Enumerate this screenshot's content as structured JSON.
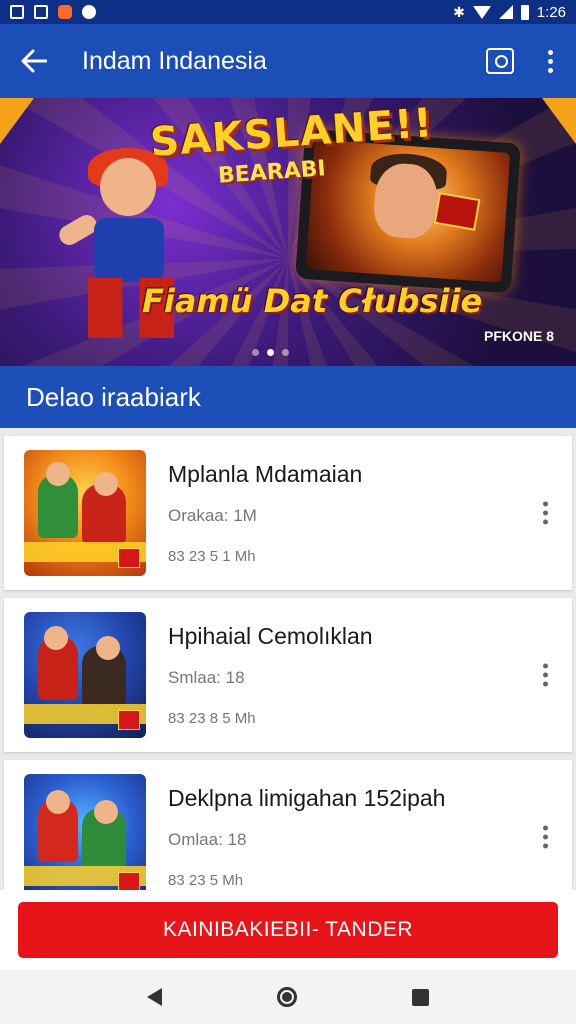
{
  "status_bar": {
    "time": "1:26"
  },
  "app_bar": {
    "title": "Indam Indanesia"
  },
  "banner": {
    "headline": "SAKSLANE!!",
    "sub": "BEARABI",
    "tagline": "Fiamü Dat Cłubsiie",
    "code": "PFKONE 8"
  },
  "section": {
    "title": "Delao iraabiark"
  },
  "items": [
    {
      "title": "Mplanla Mdamaian",
      "meta": "Orakaa: 1M",
      "size": "83 23 5 1 Mh"
    },
    {
      "title": "Hpihaial Cemolıklan",
      "meta": "Smlaa: 18",
      "size": "83 23 8 5 Mh"
    },
    {
      "title": "Deklpna limigahan 152ipah",
      "meta": "Omlaa: 18",
      "size": "83 23 5 Mh"
    }
  ],
  "action": {
    "label": "KAINIBAKIEBII- TANDER"
  }
}
